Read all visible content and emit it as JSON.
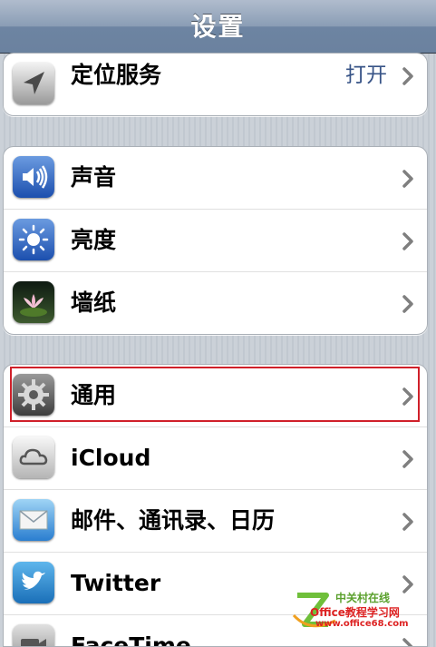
{
  "nav": {
    "title": "设置"
  },
  "groups": [
    {
      "rows": [
        {
          "label": "定位服务",
          "value": "打开",
          "icon": "location-arrow-icon"
        }
      ]
    },
    {
      "rows": [
        {
          "label": "声音",
          "icon": "speaker-icon"
        },
        {
          "label": "亮度",
          "icon": "brightness-sun-icon"
        },
        {
          "label": "墙纸",
          "icon": "wallpaper-lotus-icon"
        }
      ]
    },
    {
      "rows": [
        {
          "label": "通用",
          "icon": "gear-icon",
          "highlighted": true
        },
        {
          "label": "iCloud",
          "icon": "cloud-icon"
        },
        {
          "label": "邮件、通讯录、日历",
          "icon": "mail-envelope-icon"
        },
        {
          "label": "Twitter",
          "icon": "twitter-bird-icon"
        },
        {
          "label": "FaceTime",
          "icon": "facetime-camera-icon"
        }
      ]
    }
  ],
  "watermark": {
    "line1": "中关村在线",
    "line2": "Office教程学习网",
    "line3": "www.office68.com"
  },
  "colors": {
    "highlight": "#d0202a",
    "value_text": "#385487",
    "nav_top": "#b0bccd",
    "nav_bottom": "#6b829f"
  }
}
